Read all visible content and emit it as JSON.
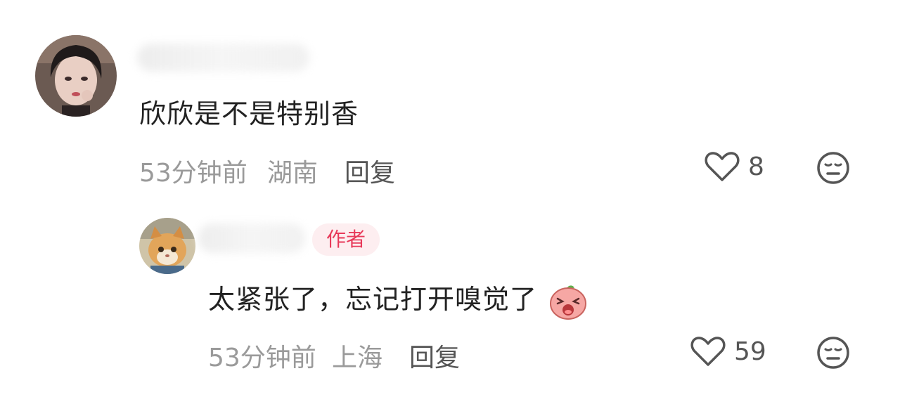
{
  "comments": [
    {
      "text": "欣欣是不是特别香",
      "time": "53分钟前",
      "location": "湖南",
      "reply_label": "回复",
      "likes": "8",
      "like_icon": "heart-outline-icon",
      "dislike_icon": "neutral-face-icon"
    }
  ],
  "replies": [
    {
      "badge": "作者",
      "text": "太紧张了，忘记打开嗅觉了",
      "emoji": "crying-peach-emoji",
      "time": "53分钟前",
      "location": "上海",
      "reply_label": "回复",
      "likes": "59",
      "like_icon": "heart-outline-icon",
      "dislike_icon": "neutral-face-icon"
    }
  ],
  "colors": {
    "badge_bg": "#fdeef0",
    "badge_text": "#e83a5a",
    "meta_text": "#9a9a9a",
    "body_text": "#222222"
  }
}
